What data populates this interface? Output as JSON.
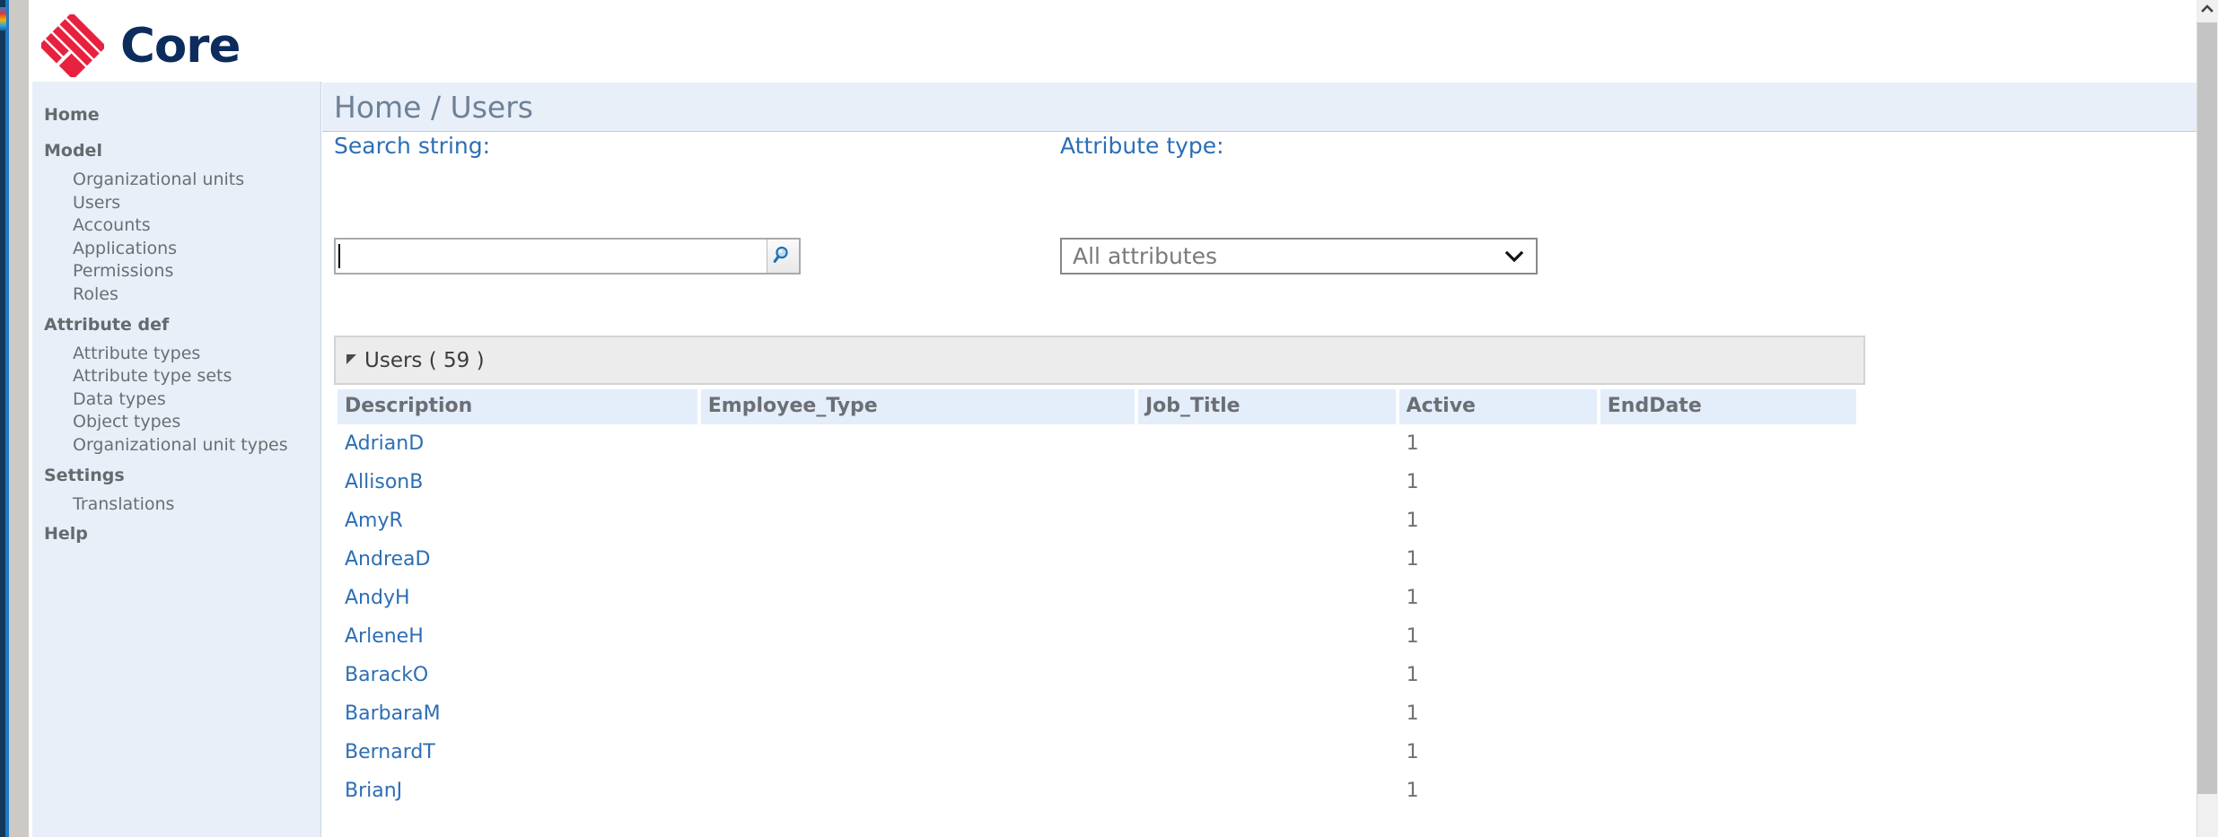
{
  "brand": {
    "name": "Core",
    "logo_icon": "diamond-stripes-logo",
    "logo_color": "#e8213f",
    "text_color": "#0d2c5e"
  },
  "sidebar": {
    "groups": [
      {
        "header": "Home",
        "items": []
      },
      {
        "header": "Model",
        "items": [
          "Organizational units",
          "Users",
          "Accounts",
          "Applications",
          "Permissions",
          "Roles"
        ]
      },
      {
        "header": "Attribute def",
        "items": [
          "Attribute types",
          "Attribute type sets",
          "Data types",
          "Object types",
          "Organizational unit types"
        ]
      },
      {
        "header": "Settings",
        "items": [
          "Translations"
        ]
      },
      {
        "header": "Help",
        "items": []
      }
    ]
  },
  "breadcrumb": {
    "text": "Home / Users"
  },
  "search": {
    "label": "Search string:",
    "value": "",
    "placeholder": "",
    "button_icon": "search-icon"
  },
  "attribute_type": {
    "label": "Attribute type:",
    "selected": "All attributes",
    "chevron_icon": "chevron-down-icon"
  },
  "panel": {
    "title": "Users ( 59 )",
    "collapse_icon": "collapse-triangle-icon"
  },
  "table": {
    "columns": [
      "Description",
      "Employee_Type",
      "Job_Title",
      "Active",
      "EndDate"
    ],
    "rows": [
      {
        "description": "AdrianD",
        "employee_type": "",
        "job_title": "",
        "active": "1",
        "end_date": ""
      },
      {
        "description": "AllisonB",
        "employee_type": "",
        "job_title": "",
        "active": "1",
        "end_date": ""
      },
      {
        "description": "AmyR",
        "employee_type": "",
        "job_title": "",
        "active": "1",
        "end_date": ""
      },
      {
        "description": "AndreaD",
        "employee_type": "",
        "job_title": "",
        "active": "1",
        "end_date": ""
      },
      {
        "description": "AndyH",
        "employee_type": "",
        "job_title": "",
        "active": "1",
        "end_date": ""
      },
      {
        "description": "ArleneH",
        "employee_type": "",
        "job_title": "",
        "active": "1",
        "end_date": ""
      },
      {
        "description": "BarackO",
        "employee_type": "",
        "job_title": "",
        "active": "1",
        "end_date": ""
      },
      {
        "description": "BarbaraM",
        "employee_type": "",
        "job_title": "",
        "active": "1",
        "end_date": ""
      },
      {
        "description": "BernardT",
        "employee_type": "",
        "job_title": "",
        "active": "1",
        "end_date": ""
      },
      {
        "description": "BrianJ",
        "employee_type": "",
        "job_title": "",
        "active": "1",
        "end_date": ""
      }
    ]
  },
  "scrollbar": {
    "up_icon": "chevron-up-icon"
  },
  "colors": {
    "sidebar_bg": "#e9eff9",
    "breadcrumb_bg": "#e9eff9",
    "link_blue": "#2d6eb5",
    "header_cell_bg": "#e4edfa",
    "panel_bg": "#ececec"
  }
}
